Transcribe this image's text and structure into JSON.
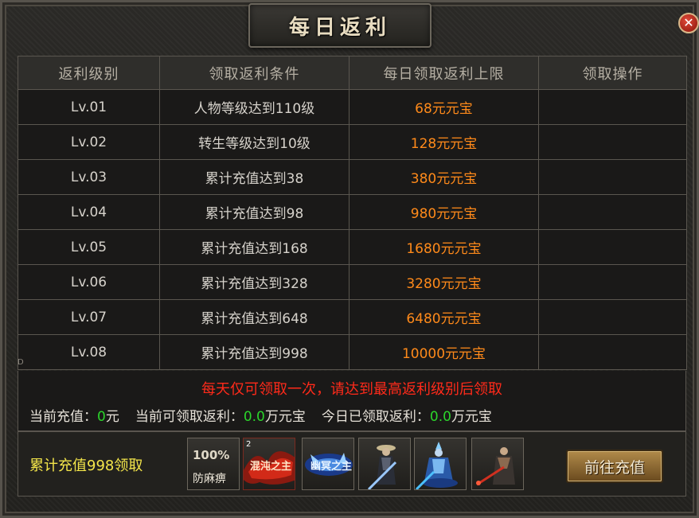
{
  "dialog": {
    "title": "每日返利",
    "close_icon": "✕"
  },
  "table": {
    "headers": [
      "返利级别",
      "领取返利条件",
      "每日领取返利上限",
      "领取操作"
    ],
    "rows": [
      {
        "level": "Lv.01",
        "condition": "人物等级达到110级",
        "reward": "68元元宝",
        "action": ""
      },
      {
        "level": "Lv.02",
        "condition": "转生等级达到10级",
        "reward": "128元元宝",
        "action": ""
      },
      {
        "level": "Lv.03",
        "condition": "累计充值达到38",
        "reward": "380元元宝",
        "action": ""
      },
      {
        "level": "Lv.04",
        "condition": "累计充值达到98",
        "reward": "980元元宝",
        "action": ""
      },
      {
        "level": "Lv.05",
        "condition": "累计充值达到168",
        "reward": "1680元元宝",
        "action": ""
      },
      {
        "level": "Lv.06",
        "condition": "累计充值达到328",
        "reward": "3280元元宝",
        "action": ""
      },
      {
        "level": "Lv.07",
        "condition": "累计充值达到648",
        "reward": "6480元元宝",
        "action": ""
      },
      {
        "level": "Lv.08",
        "condition": "累计充值达到998",
        "reward": "10000元元宝",
        "action": ""
      }
    ]
  },
  "notice": "每天仅可领取一次，请达到最高返利级别后领取",
  "stats": {
    "current_recharge_label": "当前充值：",
    "current_recharge_value": "0",
    "current_recharge_unit": "元",
    "claimable_label": "当前可领取返利：",
    "claimable_value": "0.0",
    "claimable_unit": "万元宝",
    "claimed_label": "今日已领取返利：",
    "claimed_value": "0.0",
    "claimed_unit": "万元宝"
  },
  "reward_bar": {
    "label": "累计充值998领取",
    "items": [
      {
        "kind": "badge",
        "percent": "100%",
        "name": "防麻痹"
      },
      {
        "kind": "title-banner",
        "count": "2",
        "text": "混沌之主"
      },
      {
        "kind": "title-banner",
        "text": "幽冥之主"
      },
      {
        "kind": "character"
      },
      {
        "kind": "character"
      },
      {
        "kind": "character"
      }
    ],
    "go_button": "前往充值"
  },
  "side": {
    "left_text": "D"
  },
  "colors": {
    "reward": "#ff8a1a",
    "notice": "#ff2a1a",
    "value_green": "#2bd42b",
    "reward_label": "#f3e54a"
  }
}
